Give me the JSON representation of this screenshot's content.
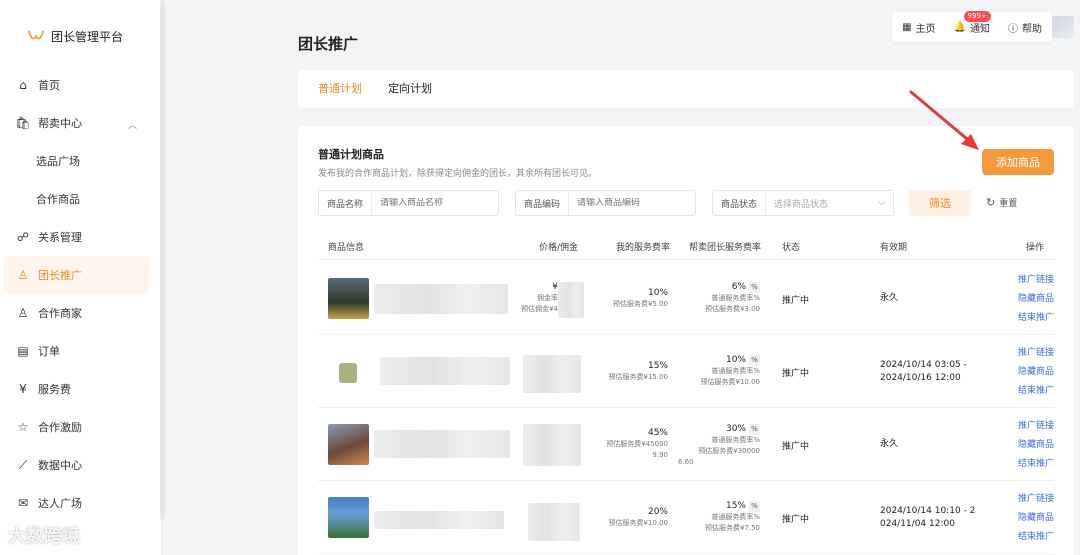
{
  "app": {
    "title": "团长管理平台"
  },
  "sidebar": {
    "items": [
      {
        "label": "首页",
        "icon": "home-icon"
      },
      {
        "label": "帮卖中心",
        "icon": "bag-icon",
        "expanded": true
      },
      {
        "label": "选品广场",
        "sub": true
      },
      {
        "label": "合作商品",
        "sub": true
      },
      {
        "label": "关系管理",
        "icon": "relation-icon"
      },
      {
        "label": "团长推广",
        "icon": "user-icon",
        "active": true
      },
      {
        "label": "合作商家",
        "icon": "user-add-icon"
      },
      {
        "label": "订单",
        "icon": "order-icon"
      },
      {
        "label": "服务费",
        "icon": "yen-icon"
      },
      {
        "label": "合作激励",
        "icon": "star-icon"
      },
      {
        "label": "数据中心",
        "icon": "chart-icon"
      },
      {
        "label": "达人广场",
        "icon": "mail-icon"
      }
    ]
  },
  "topbar": {
    "home": "主页",
    "notice": "通知",
    "notice_badge": "999+",
    "help": "帮助"
  },
  "page": {
    "title": "团长推广"
  },
  "tabs": [
    {
      "label": "普通计划",
      "active": true
    },
    {
      "label": "定向计划"
    }
  ],
  "section": {
    "title": "普通计划商品",
    "desc": "发布我的合作商品计划，除获得定向佣金的团长，其余所有团长可见。",
    "add_button": "添加商品"
  },
  "filters": {
    "name_label": "商品名称",
    "name_placeholder": "请输入商品名称",
    "code_label": "商品编码",
    "code_placeholder": "请输入商品编码",
    "status_label": "商品状态",
    "status_placeholder": "选择商品状态",
    "filter_button": "筛选",
    "reset_button": "重置"
  },
  "table": {
    "headers": {
      "info": "商品信息",
      "price": "价格/佣金",
      "my_rate": "我的服务费率",
      "helper_rate": "帮卖团长服务费率",
      "status": "状态",
      "validity": "有效期",
      "ops": "操作"
    },
    "rows": [
      {
        "price_top": "¥",
        "price_mid": "佣金率",
        "price_bot": "预估佣金¥4",
        "my_rate": "10%",
        "my_est": "预估服务费¥5.00",
        "helper_rate": "6%",
        "helper_sub": "普通服务费率%",
        "helper_est": "预估服务费¥3.00",
        "status": "推广中",
        "validity1": "永久",
        "validity2": "",
        "thumb": "#3d4a36"
      },
      {
        "price_top": "",
        "price_mid": "",
        "price_bot": "",
        "my_rate": "15%",
        "my_est": "预估服务费¥15.00",
        "helper_rate": "10%",
        "helper_sub": "普通服务费率%",
        "helper_est": "预估服务费¥10.00",
        "status": "推广中",
        "validity1": "2024/10/14 03:05 -",
        "validity2": "2024/10/16 12:00",
        "thumb": "#eef0e6"
      },
      {
        "price_top": "",
        "price_mid": "",
        "price_bot": "",
        "my_rate": "45%",
        "my_est": "预估服务费¥45000",
        "my_est2": "9.90",
        "helper_rate": "30%",
        "helper_sub": "普通服务费率%",
        "helper_est": "预估服务费¥30000",
        "helper_est2": "6.60",
        "status": "推广中",
        "validity1": "永久",
        "validity2": "",
        "thumb": "#7a5a45"
      },
      {
        "price_top": "",
        "price_mid": "",
        "price_bot": "",
        "my_rate": "20%",
        "my_est": "预估服务费¥10.00",
        "helper_rate": "15%",
        "helper_sub": "普通服务费率%",
        "helper_est": "预估服务费¥7.50",
        "status": "推广中",
        "validity1": "2024/10/14 10:10 - 2",
        "validity2": "024/11/04 12:00",
        "thumb": "#4f8fbf"
      }
    ],
    "ops": {
      "link": "推广链接",
      "hide": "隐藏商品",
      "end": "结束推广"
    },
    "pct_icon": "%"
  },
  "watermark": "大数跨境",
  "colors": {
    "accent": "#f08a2a",
    "button": "#f59a3c",
    "link": "#3a6fd8",
    "badge": "#ff4d4f"
  }
}
